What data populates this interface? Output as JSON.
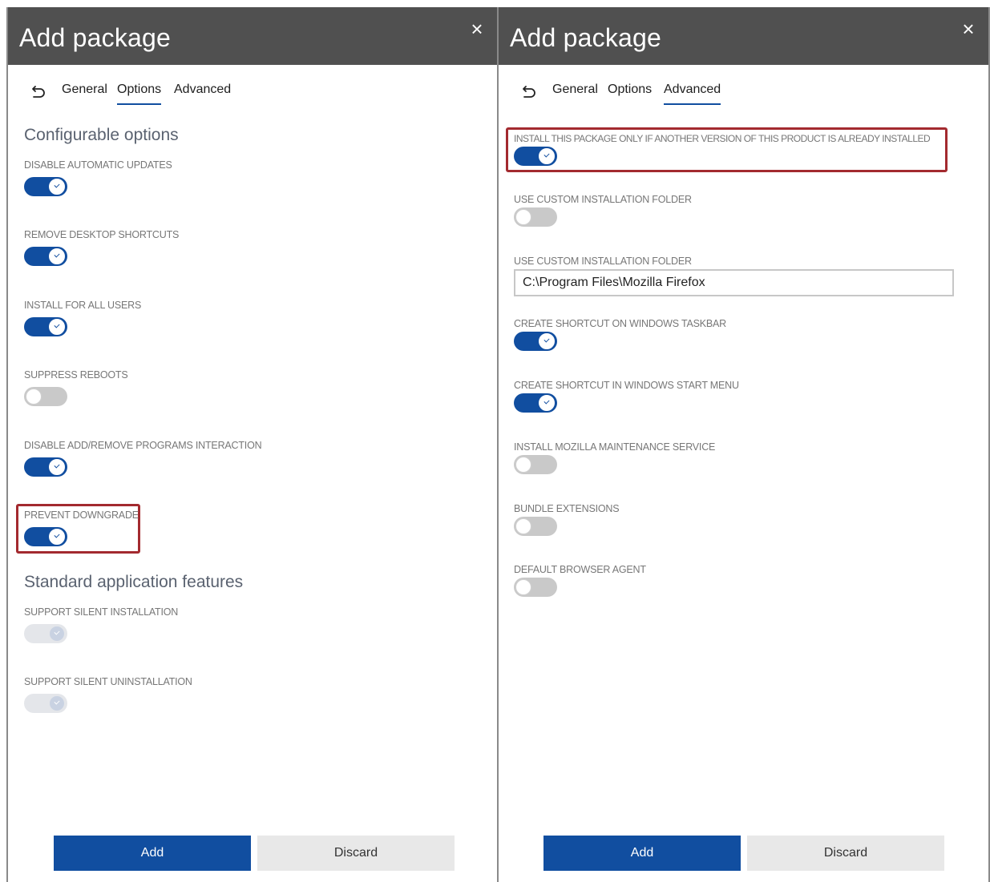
{
  "left": {
    "title": "Add package",
    "close_icon": "×",
    "tabs": [
      {
        "label": "General",
        "active": false
      },
      {
        "label": "Options",
        "active": true
      },
      {
        "label": "Advanced",
        "active": false
      }
    ],
    "section1_title": "Configurable options",
    "options": [
      {
        "label": "DISABLE AUTOMATIC UPDATES",
        "state": "on"
      },
      {
        "label": "REMOVE DESKTOP SHORTCUTS",
        "state": "on"
      },
      {
        "label": "INSTALL FOR ALL USERS",
        "state": "on"
      },
      {
        "label": "SUPPRESS REBOOTS",
        "state": "off"
      },
      {
        "label": "DISABLE ADD/REMOVE PROGRAMS INTERACTION",
        "state": "on"
      },
      {
        "label": "PREVENT DOWNGRADE",
        "state": "on",
        "highlighted": true
      }
    ],
    "section2_title": "Standard application features",
    "features": [
      {
        "label": "SUPPORT SILENT INSTALLATION",
        "state": "disabled"
      },
      {
        "label": "SUPPORT SILENT UNINSTALLATION",
        "state": "disabled"
      }
    ],
    "add_label": "Add",
    "discard_label": "Discard"
  },
  "right": {
    "title": "Add package",
    "close_icon": "×",
    "tabs": [
      {
        "label": "General",
        "active": false
      },
      {
        "label": "Options",
        "active": false
      },
      {
        "label": "Advanced",
        "active": true
      }
    ],
    "options": [
      {
        "label": "INSTALL THIS PACKAGE ONLY IF ANOTHER VERSION OF THIS PRODUCT IS ALREADY INSTALLED",
        "state": "on",
        "highlighted": true
      },
      {
        "label": "USE CUSTOM INSTALLATION FOLDER",
        "state": "off"
      },
      {
        "label": "USE CUSTOM INSTALLATION FOLDER",
        "type": "input",
        "value": "C:\\Program Files\\Mozilla Firefox"
      },
      {
        "label": "CREATE SHORTCUT ON WINDOWS TASKBAR",
        "state": "on"
      },
      {
        "label": "CREATE SHORTCUT IN WINDOWS START MENU",
        "state": "on"
      },
      {
        "label": "INSTALL MOZILLA MAINTENANCE SERVICE",
        "state": "off"
      },
      {
        "label": "BUNDLE EXTENSIONS",
        "state": "off"
      },
      {
        "label": "DEFAULT BROWSER AGENT",
        "state": "off"
      }
    ],
    "add_label": "Add",
    "discard_label": "Discard"
  },
  "colors": {
    "accent": "#114ea0",
    "titlebar": "#505050",
    "highlight": "#a32a2f",
    "toggle_off": "#c9c9c9"
  }
}
